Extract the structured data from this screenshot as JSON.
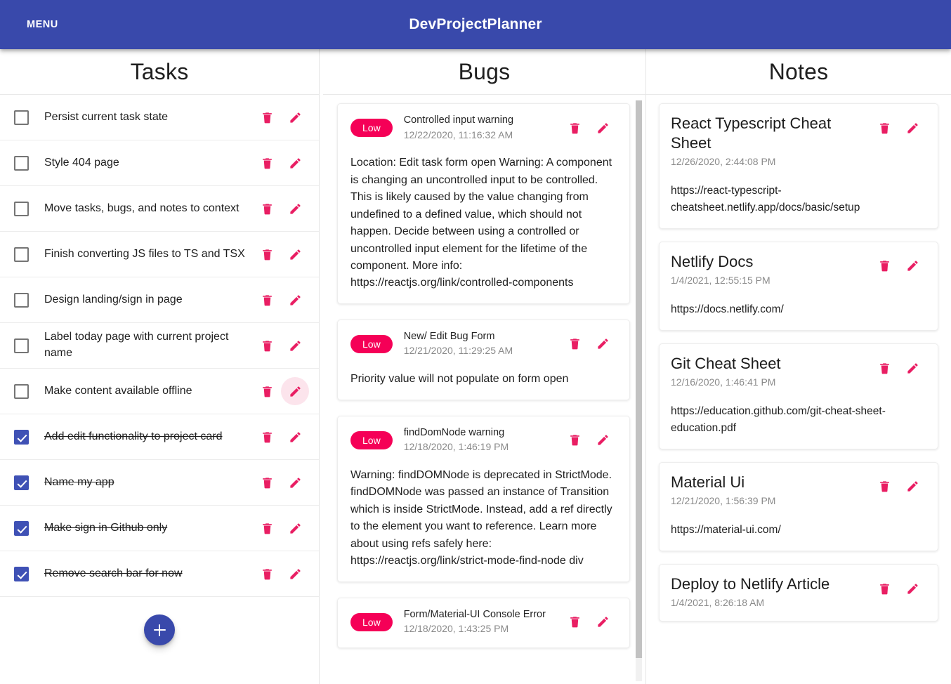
{
  "app": {
    "menu_label": "MENU",
    "title": "DevProjectPlanner",
    "accent_blue": "#3949ab",
    "checkbox_blue": "#3f51b5",
    "accent_pink": "#f50057"
  },
  "columns": {
    "tasks_title": "Tasks",
    "bugs_title": "Bugs",
    "notes_title": "Notes"
  },
  "icons": {
    "delete": "trash-icon",
    "edit": "pencil-icon",
    "add": "plus-icon"
  },
  "tasks": {
    "add_button_label": "+",
    "items": [
      {
        "label": "Persist current task state",
        "done": false,
        "edit_hovered": false
      },
      {
        "label": "Style 404 page",
        "done": false,
        "edit_hovered": false
      },
      {
        "label": "Move tasks, bugs, and notes to context",
        "done": false,
        "edit_hovered": false
      },
      {
        "label": "Finish converting JS files to TS and TSX",
        "done": false,
        "edit_hovered": false
      },
      {
        "label": "Design landing/sign in page",
        "done": false,
        "edit_hovered": false
      },
      {
        "label": "Label today page with current project name",
        "done": false,
        "edit_hovered": false
      },
      {
        "label": "Make content available offline",
        "done": false,
        "edit_hovered": true
      },
      {
        "label": "Add edit functionality to project card",
        "done": true,
        "edit_hovered": false
      },
      {
        "label": "Name my app",
        "done": true,
        "edit_hovered": false
      },
      {
        "label": "Make sign in Github only",
        "done": true,
        "edit_hovered": false
      },
      {
        "label": "Remove search bar for now",
        "done": true,
        "edit_hovered": false
      }
    ]
  },
  "bugs": {
    "items": [
      {
        "priority": "Low",
        "title": "Controlled input warning",
        "date": "12/22/2020, 11:16:32 AM",
        "body": "Location: Edit task form open Warning: A component is changing an uncontrolled input to be controlled. This is likely caused by the value changing from undefined to a defined value, which should not happen. Decide between using a controlled or uncontrolled input element for the lifetime of the component. More info: https://reactjs.org/link/controlled-components"
      },
      {
        "priority": "Low",
        "title": "New/ Edit Bug Form",
        "date": "12/21/2020, 11:29:25 AM",
        "body": "Priority value will not populate on form open"
      },
      {
        "priority": "Low",
        "title": "findDomNode warning",
        "date": "12/18/2020, 1:46:19 PM",
        "body": "Warning: findDOMNode is deprecated in StrictMode. findDOMNode was passed an instance of Transition which is inside StrictMode. Instead, add a ref directly to the element you want to reference. Learn more about using refs safely here: https://reactjs.org/link/strict-mode-find-node div"
      },
      {
        "priority": "Low",
        "title": "Form/Material-UI Console Error",
        "date": "12/18/2020, 1:43:25 PM",
        "body": ""
      }
    ]
  },
  "notes": {
    "items": [
      {
        "title": "React Typescript Cheat Sheet",
        "date": "12/26/2020, 2:44:08 PM",
        "body": "https://react-typescript-cheatsheet.netlify.app/docs/basic/setup"
      },
      {
        "title": "Netlify Docs",
        "date": "1/4/2021, 12:55:15 PM",
        "body": "https://docs.netlify.com/"
      },
      {
        "title": "Git Cheat Sheet",
        "date": "12/16/2020, 1:46:41 PM",
        "body": "https://education.github.com/git-cheat-sheet-education.pdf"
      },
      {
        "title": "Material Ui",
        "date": "12/21/2020, 1:56:39 PM",
        "body": "https://material-ui.com/"
      },
      {
        "title": "Deploy to Netlify Article",
        "date": "1/4/2021, 8:26:18 AM",
        "body": ""
      }
    ]
  }
}
